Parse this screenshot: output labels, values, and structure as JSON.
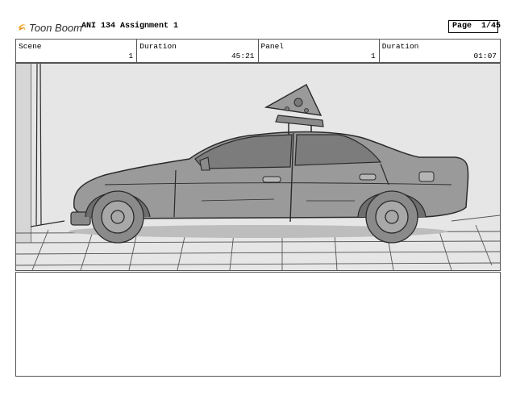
{
  "header": {
    "logo_text": "Toon Boom",
    "project_title": "ANI 134 Assignment 1",
    "page_label": "Page",
    "page_number": "1/45"
  },
  "info_bar": {
    "scene_label": "Scene",
    "scene_value": "1",
    "scene_duration_label": "Duration",
    "scene_duration_value": "45:21",
    "panel_label": "Panel",
    "panel_value": "1",
    "panel_duration_label": "Duration",
    "panel_duration_value": "01:07"
  },
  "panel": {
    "image_subject": "sedan-with-pizza-slice-roof-sign",
    "colors": {
      "background": "#e6e6e6",
      "car_body": "#9a9a9a",
      "wheel": "#8a8a8a",
      "line": "#2a2a2a"
    }
  },
  "notes": {
    "text": ""
  }
}
